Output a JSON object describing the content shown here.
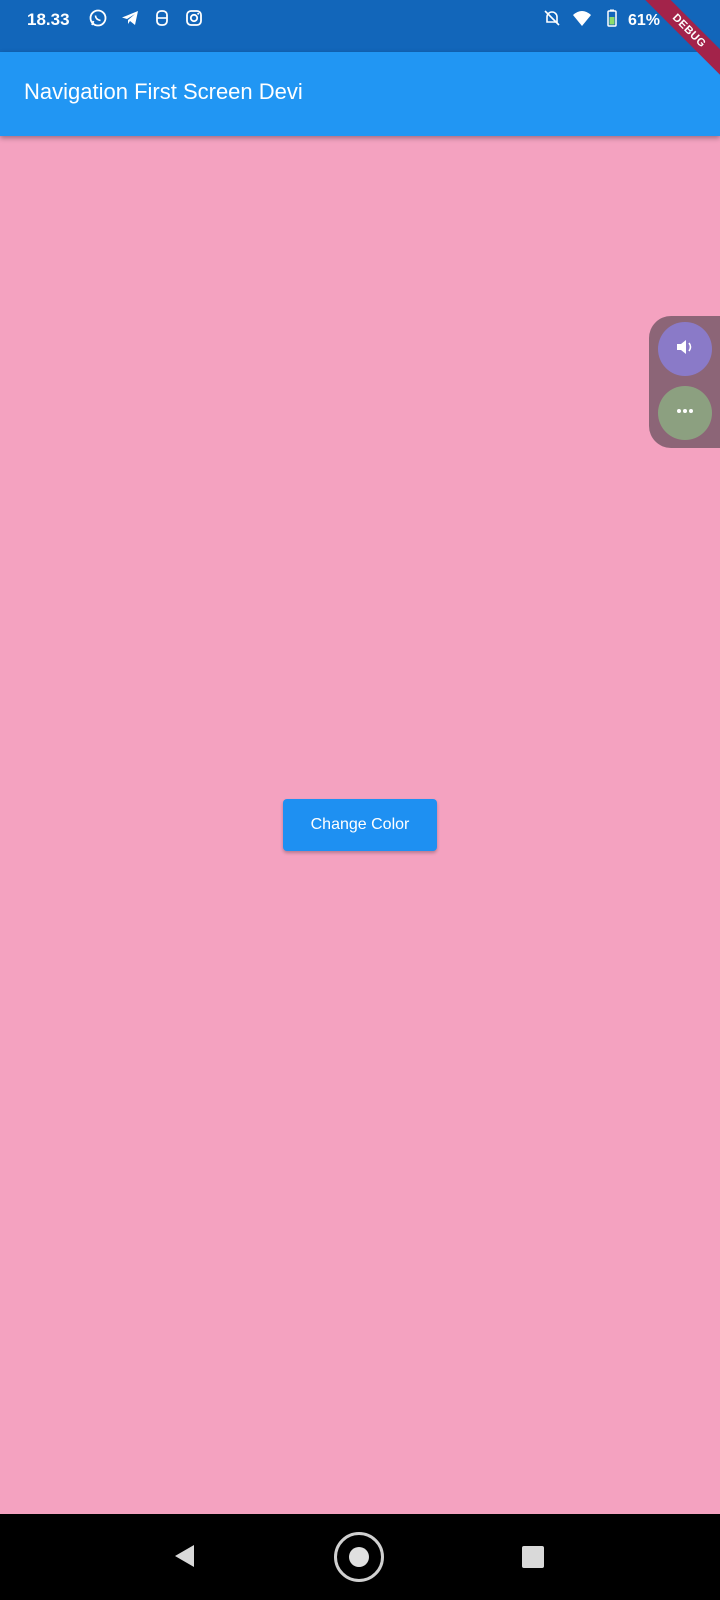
{
  "status_bar": {
    "time": "18.33",
    "battery": "61%",
    "left_icons": [
      "whatsapp-icon",
      "telegram-icon",
      "app-icon",
      "instagram-icon"
    ],
    "right_icons": [
      "bell-off-icon",
      "wifi-icon",
      "battery-icon"
    ]
  },
  "app_bar": {
    "title": "Navigation First Screen Devi"
  },
  "debug_banner": {
    "label": "DEBUG"
  },
  "main": {
    "background_color": "#f4a2c0",
    "button_label": "Change Color"
  },
  "side_panel": {
    "buttons": [
      "volume-icon",
      "more-icon"
    ]
  },
  "nav_bar": {
    "buttons": [
      "back",
      "home",
      "recents"
    ]
  },
  "colors": {
    "status_bar": "#1266ba",
    "app_bar": "#2196f3",
    "button": "#1e90f2",
    "debug_ribbon": "#a3234a"
  }
}
